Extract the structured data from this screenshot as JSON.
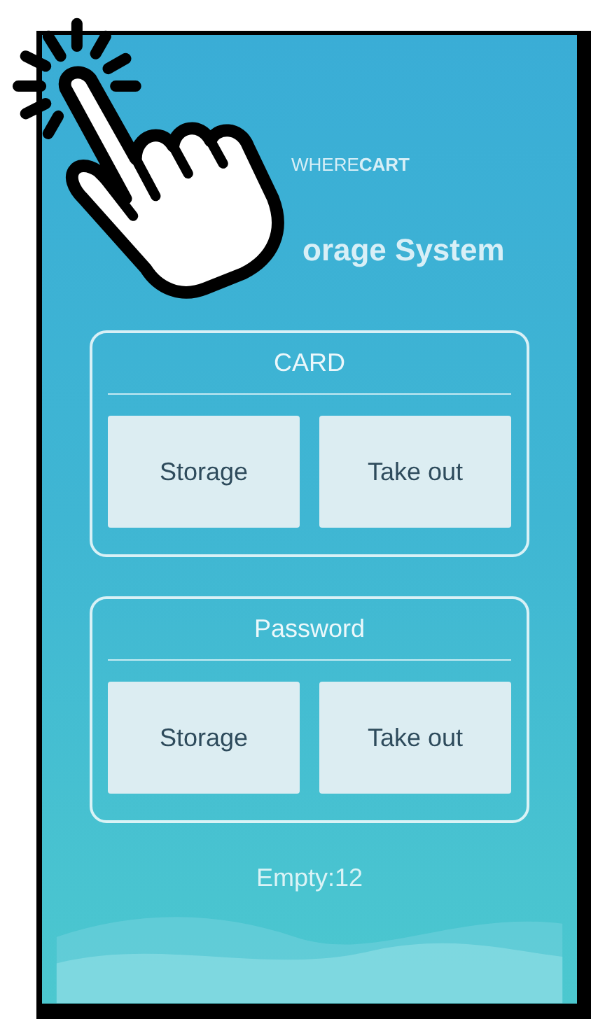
{
  "logo": {
    "light": "WHERE",
    "bold": "CART"
  },
  "title": "orage System",
  "panels": [
    {
      "title": "CARD",
      "buttons": [
        "Storage",
        "Take out"
      ]
    },
    {
      "title": "Password",
      "buttons": [
        "Storage",
        "Take out"
      ]
    }
  ],
  "status": "Empty:12"
}
